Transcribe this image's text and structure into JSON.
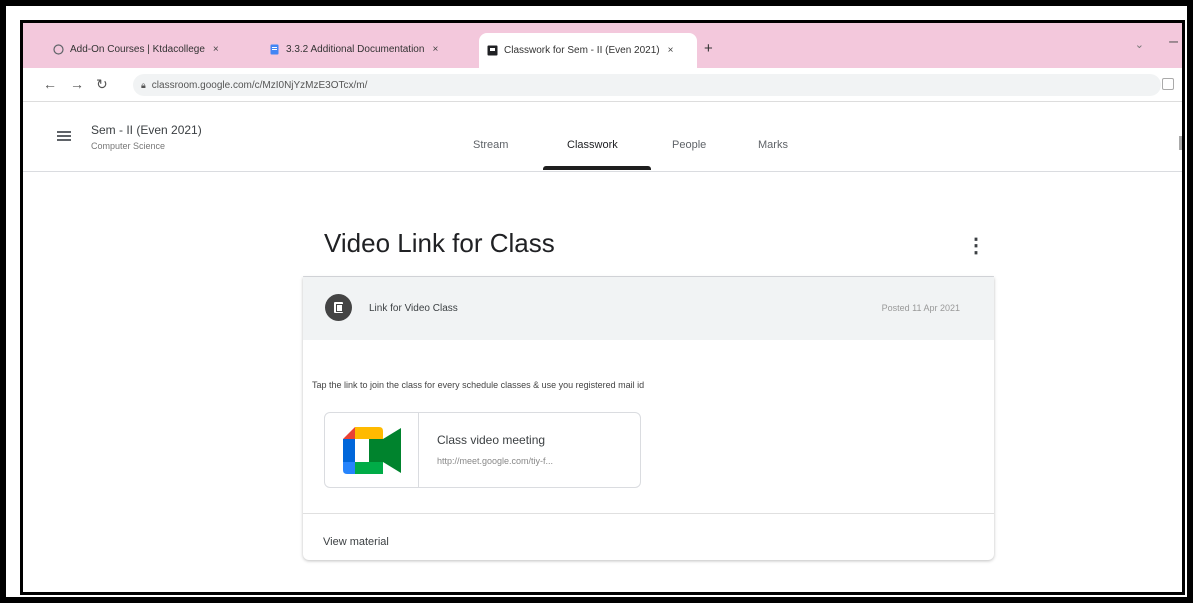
{
  "browser": {
    "tabs": [
      {
        "label": "Add-On Courses | Ktdacollege",
        "favicon_color": "#9aa0a6"
      },
      {
        "label": "3.3.2 Additional Documentation",
        "favicon_color": "#4285f4"
      },
      {
        "label": "Classwork for Sem - II (Even 2021)",
        "favicon_color": "#202124"
      }
    ],
    "close_glyph": "×",
    "new_tab_glyph": "+",
    "url": "classroom.google.com/c/MzI0NjYzMzE3OTcx/m/"
  },
  "header": {
    "class_title": "Sem - II (Even 2021)",
    "class_subtitle": "Computer Science",
    "nav": [
      "Stream",
      "Classwork",
      "People",
      "Marks"
    ],
    "active_nav_index": 1
  },
  "main": {
    "heading": "Video Link for Class",
    "material": {
      "title": "Link for Video Class",
      "posted": "Posted 11 Apr 2021",
      "description": "Tap the link to join the class for every schedule classes & use you registered mail id",
      "attachment": {
        "title": "Class video meeting",
        "url": "http://meet.google.com/tiy-f..."
      },
      "view_label": "View material"
    }
  },
  "colors": {
    "tab_strip": "#f3c8dc",
    "meet_green": "#00832d",
    "meet_blue": "#0066da",
    "meet_yellow": "#ffba00",
    "meet_red": "#e94235"
  }
}
